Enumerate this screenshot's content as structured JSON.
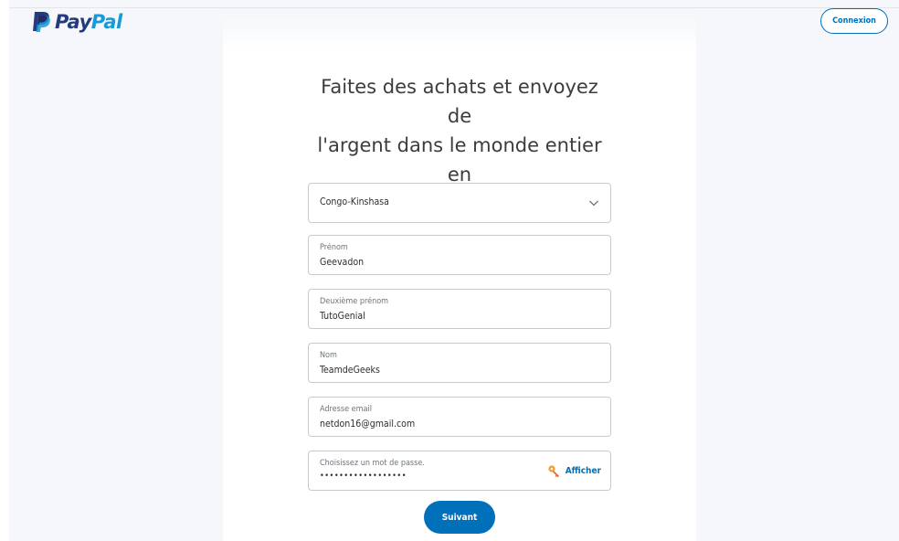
{
  "header": {
    "logo_pay": "Pay",
    "logo_pal": "Pal",
    "login_label": "Connexion"
  },
  "form": {
    "title": "Faites des achats et envoyez de\nl'argent dans le monde entier en\nun clin d'œil.",
    "country": {
      "value": "Congo-Kinshasa",
      "icon": "chevron-down-icon"
    },
    "first_name": {
      "label": "Prénom",
      "value": "Geevadon"
    },
    "middle_name": {
      "label": "Deuxième prénom",
      "value": "TutoGenial"
    },
    "last_name": {
      "label": "Nom",
      "value": "TeamdeGeeks"
    },
    "email": {
      "label": "Adresse email",
      "value": "netdon16@gmail.com"
    },
    "password": {
      "label": "Choisissez un mot de passe.",
      "value": "••••••••••••••••••",
      "show_label": "Afficher",
      "icon": "key-icon"
    },
    "next_label": "Suivant"
  },
  "colors": {
    "brand_dark": "#253b80",
    "brand_light": "#179bd7",
    "accent": "#0070ba",
    "field_border": "#c8cacd"
  }
}
